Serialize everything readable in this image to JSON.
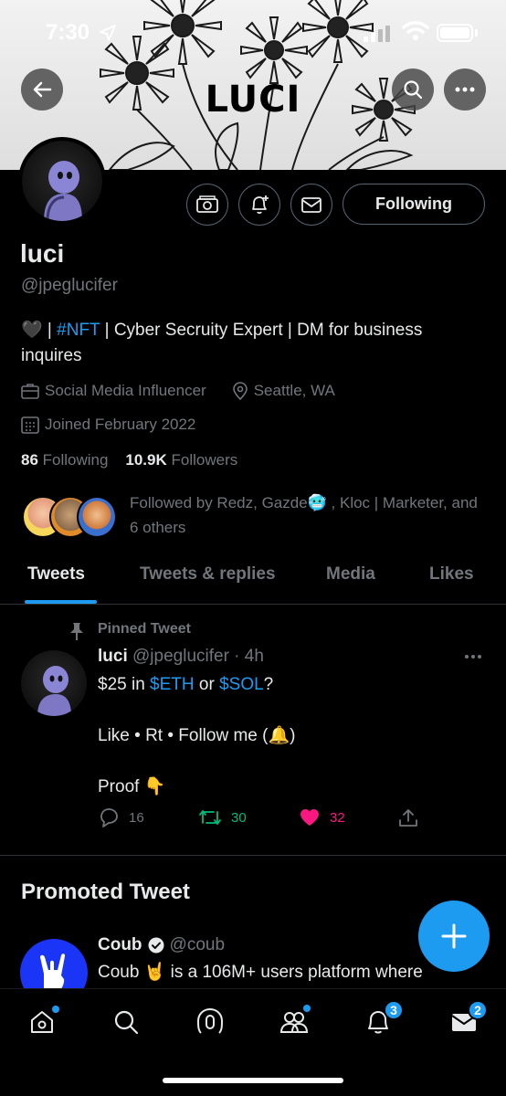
{
  "status_bar": {
    "time": "7:30"
  },
  "banner": {
    "title": "LUCI"
  },
  "profile": {
    "display_name": "luci",
    "handle": "@jpeglucifer",
    "following_button": "Following",
    "bio_prefix": "🖤 | ",
    "bio_hashtag": "#NFT",
    "bio_rest": " | Cyber Secruity Expert | DM for business inquires",
    "category": "Social Media Influencer",
    "location": "Seattle, WA",
    "joined": "Joined February 2022",
    "following_count": "86",
    "following_label": "Following",
    "followers_count": "10.9K",
    "followers_label": "Followers",
    "followed_by": "Followed by Redz, Gazde🥶 , Kloc | Marketer, and 6 others"
  },
  "tabs": [
    {
      "label": "Tweets",
      "active": true
    },
    {
      "label": "Tweets & replies",
      "active": false
    },
    {
      "label": "Media",
      "active": false
    },
    {
      "label": "Likes",
      "active": false
    }
  ],
  "pinned_tweet": {
    "pinned_label": "Pinned Tweet",
    "author": "luci",
    "handle_time": "@jpeglucifer · 4h",
    "line1_prefix": "$25 in ",
    "cashtag1": "$ETH",
    "line1_mid": " or ",
    "cashtag2": "$SOL",
    "line1_suffix": "?",
    "line2": "Like • Rt • Follow me (🔔)",
    "line3": "Proof 👇",
    "replies": "16",
    "retweets": "30",
    "likes": "32"
  },
  "promoted": {
    "section_title": "Promoted Tweet",
    "author": "Coub",
    "handle": "@coub",
    "text": "Coub 🤘 is a 106M+ users platform where"
  },
  "bottom_nav": {
    "notifications_badge": "3",
    "messages_badge": "2"
  },
  "colors": {
    "accent": "#1d9bf0",
    "retweet": "#00ba7c",
    "like": "#f91880",
    "muted": "#71767b",
    "background": "#000000"
  }
}
